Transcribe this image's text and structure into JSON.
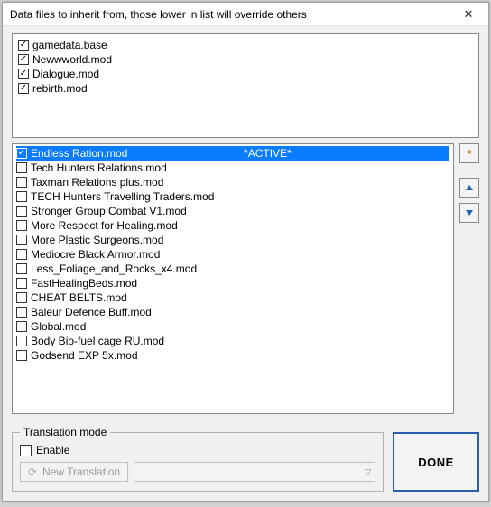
{
  "title": "Data files to inherit from, those lower in list will override others",
  "base_files": [
    {
      "name": "gamedata.base",
      "checked": true
    },
    {
      "name": "Newwworld.mod",
      "checked": true
    },
    {
      "name": "Dialogue.mod",
      "checked": true
    },
    {
      "name": "rebirth.mod",
      "checked": true
    }
  ],
  "mods": [
    {
      "name": "Endless Ration.mod",
      "checked": true,
      "selected": true,
      "active_label": "*ACTIVE*"
    },
    {
      "name": "Tech Hunters Relations.mod",
      "checked": false,
      "selected": false
    },
    {
      "name": "Taxman Relations plus.mod",
      "checked": false,
      "selected": false
    },
    {
      "name": "TECH Hunters Travelling Traders.mod",
      "checked": false,
      "selected": false
    },
    {
      "name": "Stronger Group Combat V1.mod",
      "checked": false,
      "selected": false
    },
    {
      "name": "More Respect for Healing.mod",
      "checked": false,
      "selected": false
    },
    {
      "name": "More Plastic Surgeons.mod",
      "checked": false,
      "selected": false
    },
    {
      "name": "Mediocre Black Armor.mod",
      "checked": false,
      "selected": false
    },
    {
      "name": "Less_Foliage_and_Rocks_x4.mod",
      "checked": false,
      "selected": false
    },
    {
      "name": "FastHealingBeds.mod",
      "checked": false,
      "selected": false
    },
    {
      "name": "CHEAT BELTS.mod",
      "checked": false,
      "selected": false
    },
    {
      "name": "Baleur Defence Buff.mod",
      "checked": false,
      "selected": false
    },
    {
      "name": "Global.mod",
      "checked": false,
      "selected": false
    },
    {
      "name": "Body Bio-fuel cage RU.mod",
      "checked": false,
      "selected": false
    },
    {
      "name": "Godsend EXP 5x.mod",
      "checked": false,
      "selected": false
    }
  ],
  "translation": {
    "group_label": "Translation mode",
    "enable_label": "Enable",
    "enabled": false,
    "new_translation_label": "New Translation",
    "dropdown_value": ""
  },
  "done_label": "DONE"
}
